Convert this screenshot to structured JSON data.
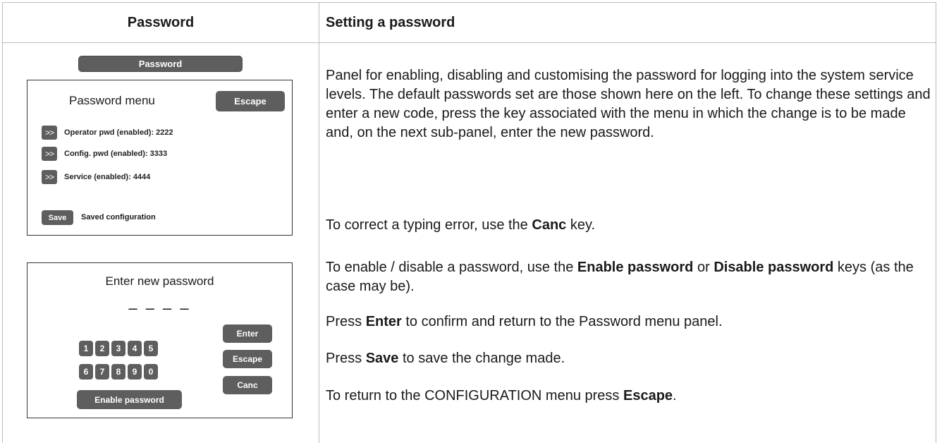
{
  "header": {
    "left_title": "Password",
    "right_title": "Setting a password"
  },
  "password_panel": {
    "tab_label": "Password",
    "menu_title": "Password menu",
    "escape_label": "Escape",
    "items": [
      {
        "chevron": ">>",
        "label": "Operator pwd (enabled): 2222"
      },
      {
        "chevron": ">>",
        "label": "Config. pwd (enabled): 3333"
      },
      {
        "chevron": ">>",
        "label": "Service (enabled): 4444"
      }
    ],
    "save_label": "Save",
    "saved_text": "Saved configuration"
  },
  "entry_panel": {
    "title": "Enter new password",
    "mask": "– – – –",
    "keys_row1": [
      "1",
      "2",
      "3",
      "4",
      "5"
    ],
    "keys_row2": [
      "6",
      "7",
      "8",
      "9",
      "0"
    ],
    "enable_label": "Enable password",
    "enter_label": "Enter",
    "escape_label": "Escape",
    "canc_label": "Canc"
  },
  "description": {
    "intro": "Panel for enabling, disabling and customising the password for logging into the system service levels. The default passwords set are those shown here on the left. To change these settings and enter a new code, press the key associated with the menu in which the change is to be made and, on the next sub-panel, enter the new password.",
    "canc": {
      "pre": "To correct a typing error, use the ",
      "b1": "Canc",
      "post": " key."
    },
    "enable": {
      "pre": "To enable / disable a password, use the ",
      "b1": "Enable password",
      "mid": " or ",
      "b2": "Disable password",
      "post": " keys (as the case may be)."
    },
    "enter": {
      "pre": "Press ",
      "b1": "Enter",
      "post": " to confirm and return to the Password menu panel."
    },
    "save": {
      "pre": "Press ",
      "b1": "Save",
      "post": " to save the change made."
    },
    "escape": {
      "pre": "To return to the CONFIGURATION menu press ",
      "b1": "Escape",
      "post": "."
    }
  }
}
